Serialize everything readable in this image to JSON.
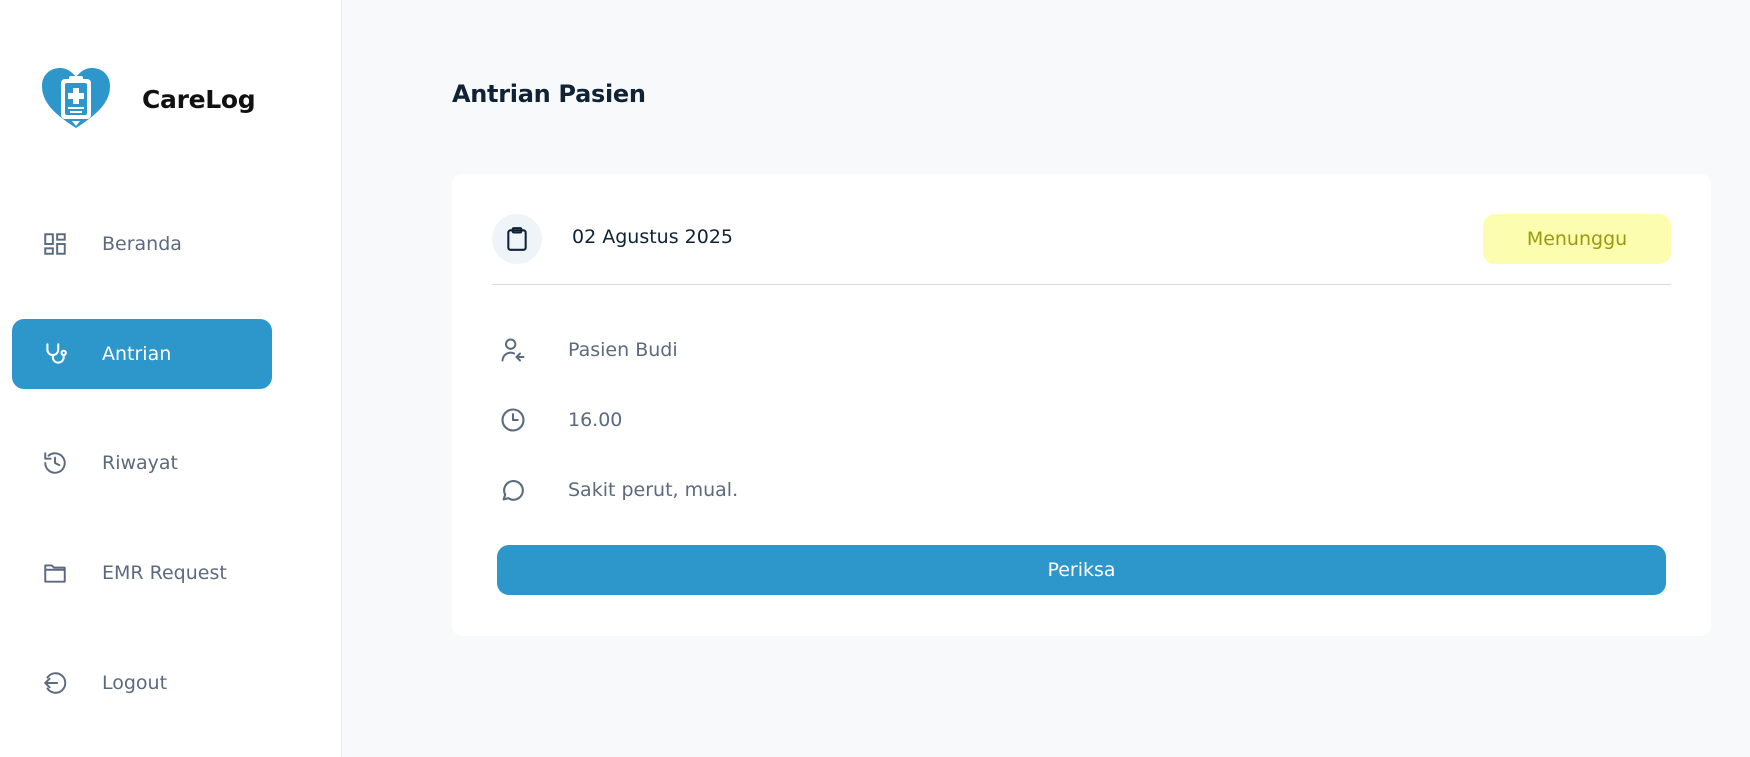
{
  "brand": {
    "name": "CareLog",
    "icon": "heart-clipboard-logo"
  },
  "sidebar": {
    "items": [
      {
        "label": "Beranda",
        "icon": "dashboard-icon",
        "active": false
      },
      {
        "label": "Antrian",
        "icon": "stethoscope-icon",
        "active": true
      },
      {
        "label": "Riwayat",
        "icon": "history-icon",
        "active": false
      },
      {
        "label": "EMR Request",
        "icon": "folder-icon",
        "active": false
      },
      {
        "label": "Logout",
        "icon": "logout-icon",
        "active": false
      }
    ]
  },
  "page": {
    "title": "Antrian Pasien"
  },
  "queue_card": {
    "date": "02 Agustus 2025",
    "date_icon": "clipboard-icon",
    "status": "Menunggu",
    "patient_name": "Pasien Budi",
    "patient_icon": "user-arrow-icon",
    "time": "16.00",
    "time_icon": "clock-icon",
    "complaint": "Sakit perut, mual.",
    "complaint_icon": "chat-bubble-icon",
    "action_label": "Periksa"
  },
  "colors": {
    "primary": "#2d96ca",
    "status_bg": "#fdfdb0",
    "status_text": "#9a9a10",
    "text_dark": "#0f2236",
    "text_muted": "#5b6a7f",
    "page_bg": "#f8f9fb"
  }
}
